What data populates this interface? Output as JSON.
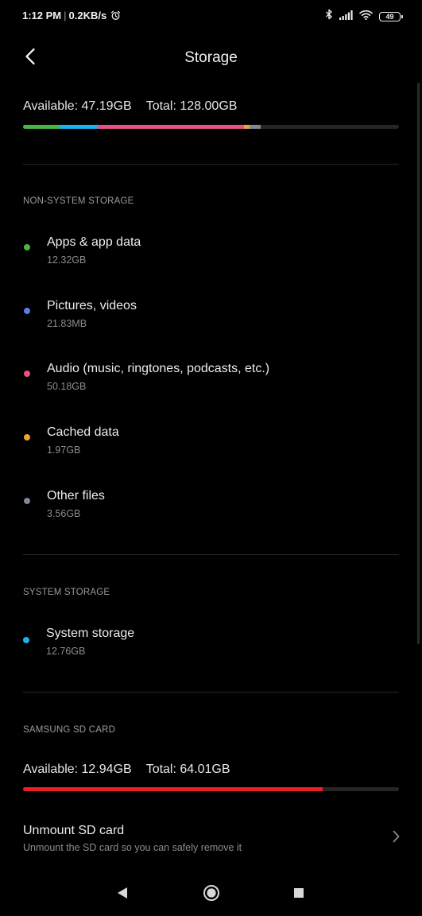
{
  "status_bar": {
    "time": "1:12 PM",
    "network_speed": "0.2KB/s",
    "battery_level": "49",
    "icons": [
      "alarm-icon",
      "bluetooth-icon",
      "signal-icon",
      "wifi-icon",
      "battery-icon"
    ]
  },
  "header": {
    "back_icon": "chevron-left-icon",
    "title": "Storage"
  },
  "internal": {
    "available": "Available: 47.19GB",
    "total": "Total: 128.00GB",
    "bar_segments": [
      {
        "category": "Apps & app data",
        "color": "#4bb543",
        "fraction": 0.0963
      },
      {
        "category": "System storage",
        "color": "#19b4f0",
        "fraction": 0.0997
      },
      {
        "category": "Audio",
        "color": "#e8508a",
        "fraction": 0.392
      },
      {
        "category": "Cached data",
        "color": "#f2a13a",
        "fraction": 0.0154
      },
      {
        "category": "Other files",
        "color": "#7d8796",
        "fraction": 0.0278
      }
    ],
    "bar_track_color": "#252525"
  },
  "non_system": {
    "header": "NON-SYSTEM STORAGE",
    "items": [
      {
        "label": "Apps & app data",
        "size": "12.32GB",
        "color": "#4bb543"
      },
      {
        "label": "Pictures, videos",
        "size": "21.83MB",
        "color": "#5b7ce8"
      },
      {
        "label": "Audio (music, ringtones, podcasts, etc.)",
        "size": "50.18GB",
        "color": "#e8508a"
      },
      {
        "label": "Cached data",
        "size": "1.97GB",
        "color": "#f2a13a"
      },
      {
        "label": "Other files",
        "size": "3.56GB",
        "color": "#7d8796"
      }
    ]
  },
  "system": {
    "header": "SYSTEM STORAGE",
    "items": [
      {
        "label": "System storage",
        "size": "12.76GB",
        "color": "#19b4f0"
      }
    ]
  },
  "sd_card": {
    "header": "SAMSUNG SD CARD",
    "available": "Available: 12.94GB",
    "total": "Total: 64.01GB",
    "used_fraction": 0.798,
    "bar_color": "#ec1c24",
    "unmount_title": "Unmount SD card",
    "unmount_subtitle": "Unmount the SD card so you can safely remove it",
    "chevron_icon": "chevron-right-icon"
  },
  "nav_bar": {
    "icons": [
      "back-triangle-icon",
      "home-circle-icon",
      "recents-square-icon"
    ]
  }
}
